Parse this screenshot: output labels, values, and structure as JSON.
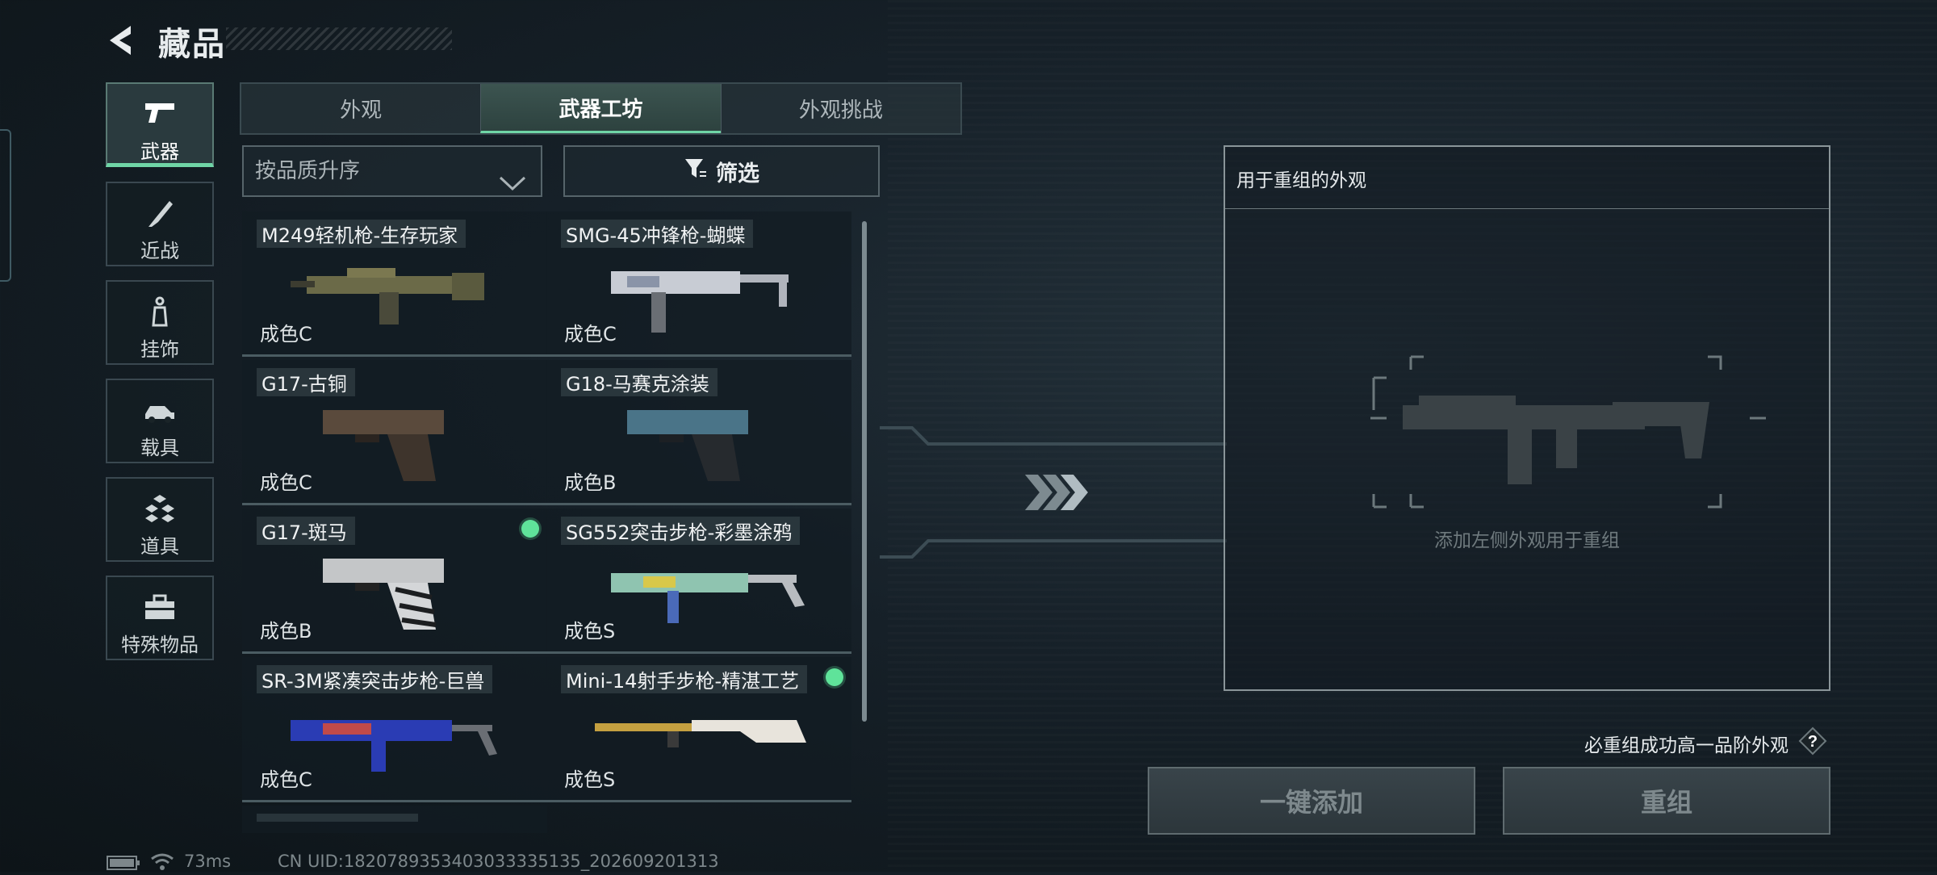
{
  "header": {
    "title": "藏品"
  },
  "sidebar": {
    "items": [
      {
        "label": "武器",
        "icon": "pistol-icon",
        "active": true
      },
      {
        "label": "近战",
        "icon": "knife-icon"
      },
      {
        "label": "挂饰",
        "icon": "charm-icon"
      },
      {
        "label": "载具",
        "icon": "vehicle-icon"
      },
      {
        "label": "道具",
        "icon": "items-icon"
      },
      {
        "label": "特殊物品",
        "icon": "toolbox-icon"
      }
    ]
  },
  "tabs": [
    {
      "label": "外观"
    },
    {
      "label": "武器工坊",
      "active": true
    },
    {
      "label": "外观挑战"
    }
  ],
  "sort": {
    "label": "按品质升序"
  },
  "filter": {
    "label": "筛选"
  },
  "items": [
    {
      "name": "M249轻机枪-生存玩家",
      "grade": "成色C"
    },
    {
      "name": "SMG-45冲锋枪-蝴蝶",
      "grade": "成色C"
    },
    {
      "name": "G17-古铜",
      "grade": "成色C"
    },
    {
      "name": "G18-马赛克涂装",
      "grade": "成色B"
    },
    {
      "name": "G17-斑马",
      "grade": "成色B",
      "new": true
    },
    {
      "name": "SG552突击步枪-彩墨涂鸦",
      "grade": "成色S"
    },
    {
      "name": "SR-3M紧凑突击步枪-巨兽",
      "grade": "成色C"
    },
    {
      "name": "Mini-14射手步枪-精湛工艺",
      "grade": "成色S",
      "new": true
    }
  ],
  "panel": {
    "title": "用于重组的外观",
    "placeholder": "添加左侧外观用于重组"
  },
  "hint": "必重组成功高一品阶外观",
  "help_icon": "question-icon",
  "buttons": {
    "add": "一键添加",
    "recombine": "重组"
  },
  "status": {
    "ping": "73ms",
    "uid": "CN UID:1820789353403033335135_202609201313"
  },
  "colors": {
    "accent": "#6fd5a6",
    "new_dot": "#5fe39a"
  }
}
